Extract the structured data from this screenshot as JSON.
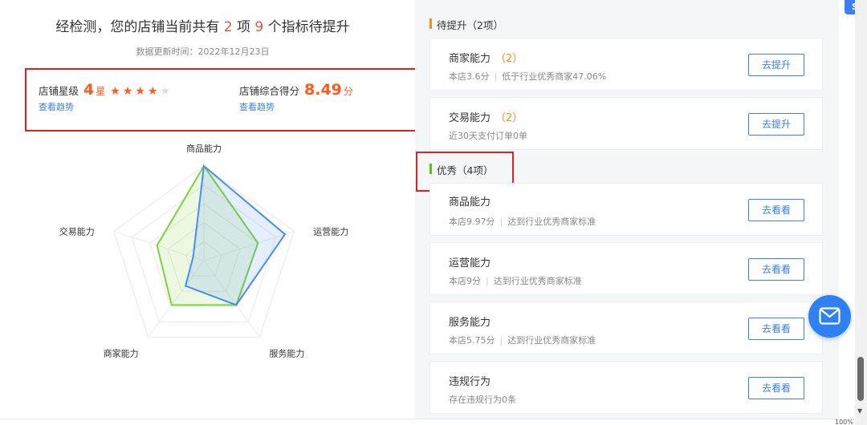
{
  "summary": {
    "prefix": "经检测，您的店铺当前共有",
    "items_count": "2",
    "items_word": "项",
    "index_count": "9",
    "suffix": "个指标待提升",
    "update_time": "数据更新时间：2022年12月23日"
  },
  "score": {
    "star_label": "店铺星级",
    "star_value": "4",
    "star_unit": "星",
    "stars_filled": 4,
    "stars_total": 5,
    "star_link": "查看趋势",
    "total_label": "店铺综合得分",
    "total_value": "8.49",
    "total_unit": "分",
    "total_link": "查看趋势"
  },
  "radar": {
    "axes": [
      "商品能力",
      "运营能力",
      "服务能力",
      "商家能力",
      "交易能力"
    ],
    "series_blue": [
      1.0,
      0.9,
      0.58,
      0.33,
      0.12
    ],
    "series_green": [
      1.0,
      0.6,
      0.58,
      0.58,
      0.52
    ],
    "colors": {
      "blue": "#4a8df0",
      "green": "#7ed23a"
    }
  },
  "right": {
    "section_pending": "待提升（2项）",
    "section_excellent": "优秀（4项）",
    "pending": [
      {
        "title": "商家能力",
        "count": "（2）",
        "desc_a": "本店3.6分",
        "desc_b": "低于行业优秀商家47.06%",
        "button": "去提升"
      },
      {
        "title": "交易能力",
        "count": "（2）",
        "desc_a": "近30天支付订单0单",
        "desc_b": "",
        "button": "去提升"
      }
    ],
    "excellent": [
      {
        "title": "商品能力",
        "desc_a": "本店9.97分",
        "desc_b": "达到行业优秀商家标准",
        "button": "去看看"
      },
      {
        "title": "运营能力",
        "desc_a": "本店9分",
        "desc_b": "达到行业优秀商家标准",
        "button": "去看看"
      },
      {
        "title": "服务能力",
        "desc_a": "本店5.75分",
        "desc_b": "达到行业优秀商家标准",
        "button": "去看看"
      },
      {
        "title": "违规行为",
        "desc_a": "存在违规行为0条",
        "desc_b": "",
        "button": "去看看"
      }
    ]
  },
  "widgets": {
    "corner_icon": "S",
    "zoom": "100%"
  }
}
